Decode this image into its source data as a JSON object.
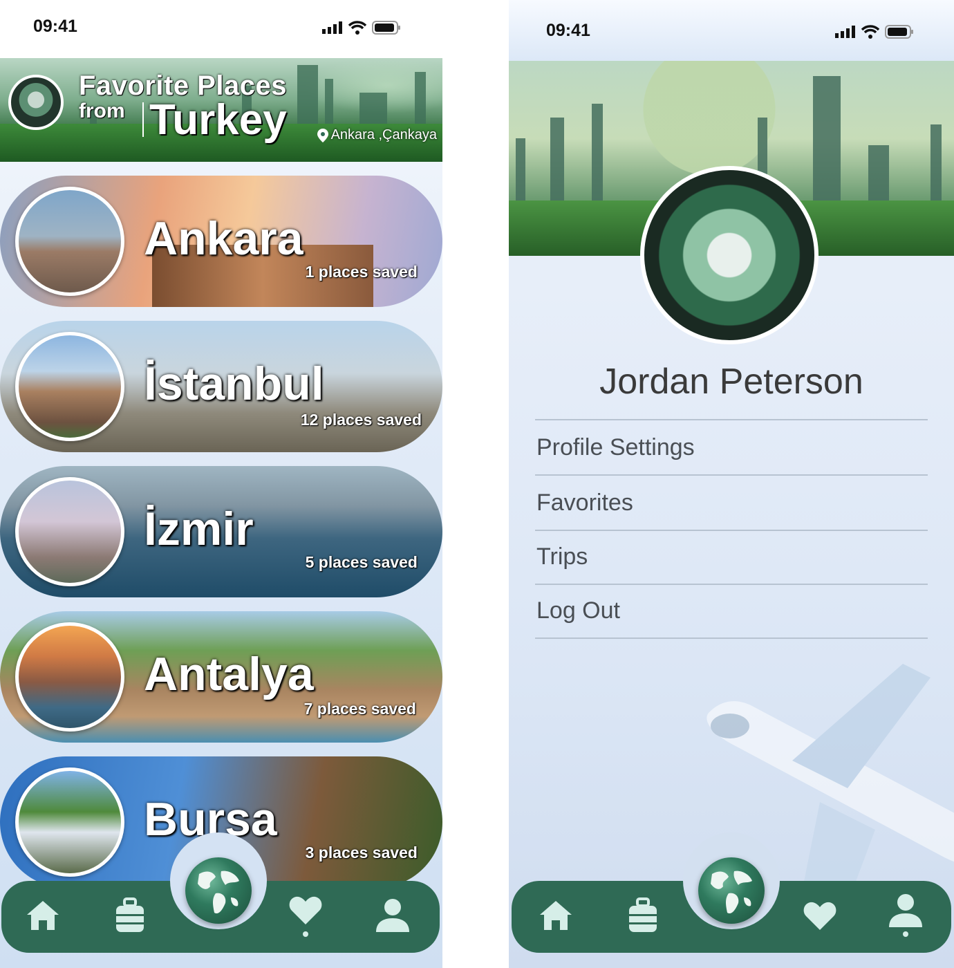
{
  "status": {
    "time_left": "09:41",
    "time_right": "09:41"
  },
  "left_screen": {
    "header": {
      "title_line1": "Favorite Places",
      "title_from": "from",
      "country": "Turkey",
      "location": "Ankara ,Çankaya"
    },
    "cities": [
      {
        "name": "Ankara",
        "count": "1 places saved"
      },
      {
        "name": "İstanbul",
        "count": "12 places saved"
      },
      {
        "name": "İzmir",
        "count": "5 places saved"
      },
      {
        "name": "Antalya",
        "count": "7 places saved"
      },
      {
        "name": "Bursa",
        "count": "3 places saved"
      }
    ]
  },
  "right_screen": {
    "profile_name": "Jordan Peterson",
    "menu": [
      "Profile Settings",
      "Favorites",
      "Trips",
      "Log Out"
    ]
  },
  "nav": {
    "icons": [
      "home-icon",
      "luggage-icon",
      "globe-icon",
      "heart-icon",
      "user-icon"
    ],
    "color": "#2f6a55"
  }
}
